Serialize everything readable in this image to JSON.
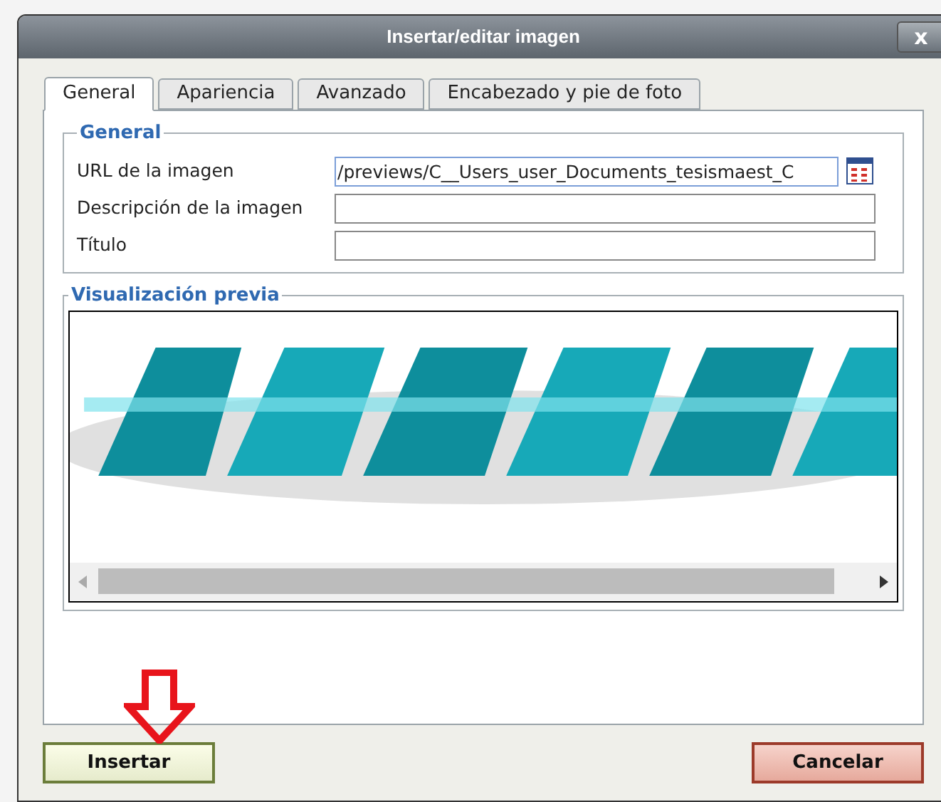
{
  "window": {
    "title": "Insertar/editar imagen",
    "close": "x"
  },
  "tabs": [
    {
      "label": "General",
      "selected": true
    },
    {
      "label": "Apariencia",
      "selected": false
    },
    {
      "label": "Avanzado",
      "selected": false
    },
    {
      "label": "Encabezado y pie de foto",
      "selected": false
    }
  ],
  "general": {
    "legend": "General",
    "fields": [
      {
        "label": "URL de la imagen",
        "value": "/previews/C__Users_user_Documents_tesismaest_C",
        "browse": true
      },
      {
        "label": "Descripción de la imagen",
        "browse": false
      },
      {
        "label": "Título",
        "browse": false
      }
    ]
  },
  "preview": {
    "legend": "Visualización previa"
  },
  "buttons": [
    {
      "label": "Insertar",
      "kind": "primary"
    },
    {
      "label": "Cancelar",
      "kind": "cancel"
    }
  ]
}
